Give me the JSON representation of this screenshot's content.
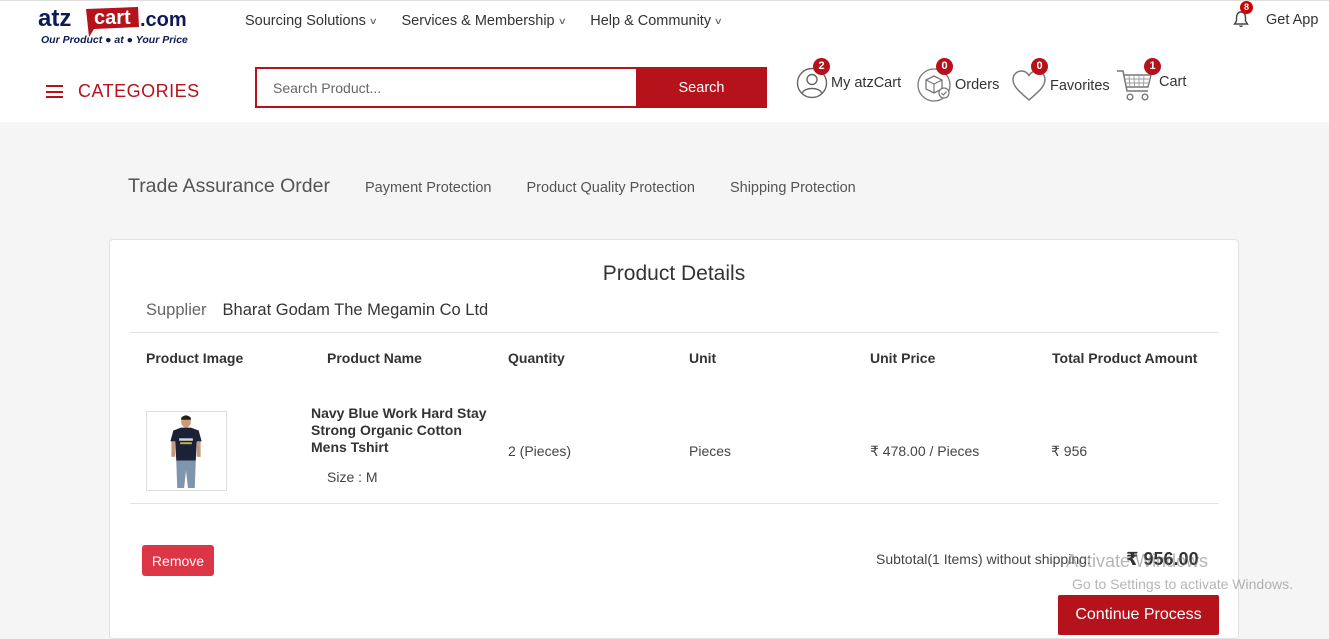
{
  "brand": {
    "logo_name": "atzcart.com",
    "logo_part1": "atz",
    "logo_part2": "cart",
    "logo_part3": ".com",
    "tagline": "Our Product ● at ● Your Price",
    "colors": {
      "primary": "#b5121b",
      "navy": "#0d1a57"
    }
  },
  "topnav": {
    "items": [
      {
        "label": "Sourcing Solutions"
      },
      {
        "label": "Services & Membership"
      },
      {
        "label": "Help & Community"
      }
    ],
    "notifications": {
      "count": "8"
    },
    "get_app": "Get App"
  },
  "header": {
    "categories_label": "CATEGORIES",
    "search": {
      "placeholder": "Search Product...",
      "value": "",
      "button_label": "Search"
    },
    "my_atzcart": {
      "label": "My atzCart",
      "badge": "2"
    },
    "orders": {
      "label": "Orders",
      "badge": "0"
    },
    "favorites": {
      "label": "Favorites",
      "badge": "0"
    },
    "cart": {
      "label": "Cart",
      "badge": "1"
    }
  },
  "trade": {
    "title": "Trade Assurance Order",
    "links": [
      {
        "label": "Payment Protection"
      },
      {
        "label": "Product Quality Protection"
      },
      {
        "label": "Shipping Protection"
      }
    ]
  },
  "product_details": {
    "title": "Product Details",
    "supplier_label": "Supplier",
    "supplier_name": "Bharat Godam The Megamin Co Ltd",
    "columns": [
      "Product Image",
      "Product Name",
      "Quantity",
      "Unit",
      "Unit Price",
      "Total Product Amount"
    ],
    "rows": [
      {
        "name": "Navy Blue Work Hard Stay Strong Organic Cotton Mens Tshirt",
        "size": "Size : M",
        "quantity": "2 (Pieces)",
        "unit": "Pieces",
        "unit_price": "₹ 478.00 / Pieces",
        "total": "₹ 956"
      }
    ],
    "remove_label": "Remove",
    "subtotal_label": "Subtotal(1 Items) without shipping:",
    "subtotal_value": "₹ 956.00",
    "continue_label": "Continue Process"
  },
  "watermark": {
    "line1": "Activate Windows",
    "line2": "Go to Settings to activate Windows."
  }
}
